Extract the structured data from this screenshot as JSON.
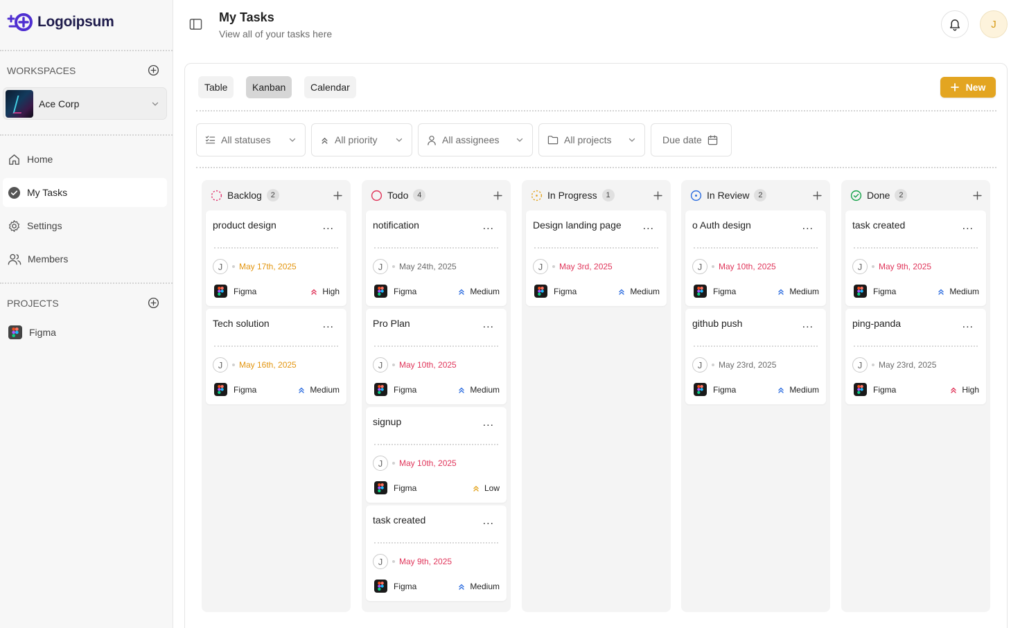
{
  "brand": {
    "name": "Logoipsum",
    "color": "#4f2fd1"
  },
  "sidebar": {
    "workspaces_label": "WORKSPACES",
    "workspace": {
      "name": "Ace Corp"
    },
    "nav": [
      {
        "label": "Home",
        "icon": "home-icon",
        "active": false
      },
      {
        "label": "My Tasks",
        "icon": "check-circle-icon",
        "active": true
      },
      {
        "label": "Settings",
        "icon": "gear-icon",
        "active": false
      },
      {
        "label": "Members",
        "icon": "users-icon",
        "active": false
      }
    ],
    "projects_label": "PROJECTS",
    "projects": [
      {
        "label": "Figma"
      }
    ]
  },
  "header": {
    "title": "My Tasks",
    "subtitle": "View all of your tasks here",
    "user_initial": "J"
  },
  "views": {
    "tabs": [
      {
        "label": "Table",
        "active": false
      },
      {
        "label": "Kanban",
        "active": true
      },
      {
        "label": "Calendar",
        "active": false
      }
    ],
    "new_label": "New"
  },
  "filters": {
    "statuses": "All statuses",
    "priority": "All priority",
    "assignees": "All assignees",
    "projects": "All projects",
    "due_date": "Due date"
  },
  "colors": {
    "accent": "#e3a521",
    "date_orange": "#e3950f",
    "date_red": "#e0355a",
    "date_gray": "#6b6b6b",
    "prio_high": "#e0355a",
    "prio_medium": "#2f6fe0",
    "prio_low": "#e3a521"
  },
  "columns": [
    {
      "name": "Backlog",
      "count": "2",
      "status": "backlog",
      "cards": [
        {
          "title": "product design",
          "assignee": "J",
          "date": "May 17th, 2025",
          "date_tone": "orange",
          "project": "Figma",
          "priority": "High"
        },
        {
          "title": "Tech solution",
          "assignee": "J",
          "date": "May 16th, 2025",
          "date_tone": "orange",
          "project": "Figma",
          "priority": "Medium"
        }
      ]
    },
    {
      "name": "Todo",
      "count": "4",
      "status": "todo",
      "cards": [
        {
          "title": "notification",
          "assignee": "J",
          "date": "May 24th, 2025",
          "date_tone": "gray",
          "project": "Figma",
          "priority": "Medium"
        },
        {
          "title": "Pro Plan",
          "assignee": "J",
          "date": "May 10th, 2025",
          "date_tone": "red",
          "project": "Figma",
          "priority": "Medium"
        },
        {
          "title": "signup",
          "assignee": "J",
          "date": "May 10th, 2025",
          "date_tone": "red",
          "project": "Figma",
          "priority": "Low"
        },
        {
          "title": "task created",
          "assignee": "J",
          "date": "May 9th, 2025",
          "date_tone": "red",
          "project": "Figma",
          "priority": "Medium"
        }
      ]
    },
    {
      "name": "In Progress",
      "count": "1",
      "status": "in-progress",
      "cards": [
        {
          "title": "Design landing page",
          "assignee": "J",
          "date": "May 3rd, 2025",
          "date_tone": "red",
          "project": "Figma",
          "priority": "Medium"
        }
      ]
    },
    {
      "name": "In Review",
      "count": "2",
      "status": "in-review",
      "cards": [
        {
          "title": "o Auth design",
          "assignee": "J",
          "date": "May 10th, 2025",
          "date_tone": "red",
          "project": "Figma",
          "priority": "Medium"
        },
        {
          "title": "github push",
          "assignee": "J",
          "date": "May 23rd, 2025",
          "date_tone": "gray",
          "project": "Figma",
          "priority": "Medium"
        }
      ]
    },
    {
      "name": "Done",
      "count": "2",
      "status": "done",
      "cards": [
        {
          "title": "task created",
          "assignee": "J",
          "date": "May 9th, 2025",
          "date_tone": "red",
          "project": "Figma",
          "priority": "Medium"
        },
        {
          "title": "ping-panda",
          "assignee": "J",
          "date": "May 23rd, 2025",
          "date_tone": "gray",
          "project": "Figma",
          "priority": "High"
        }
      ]
    }
  ]
}
